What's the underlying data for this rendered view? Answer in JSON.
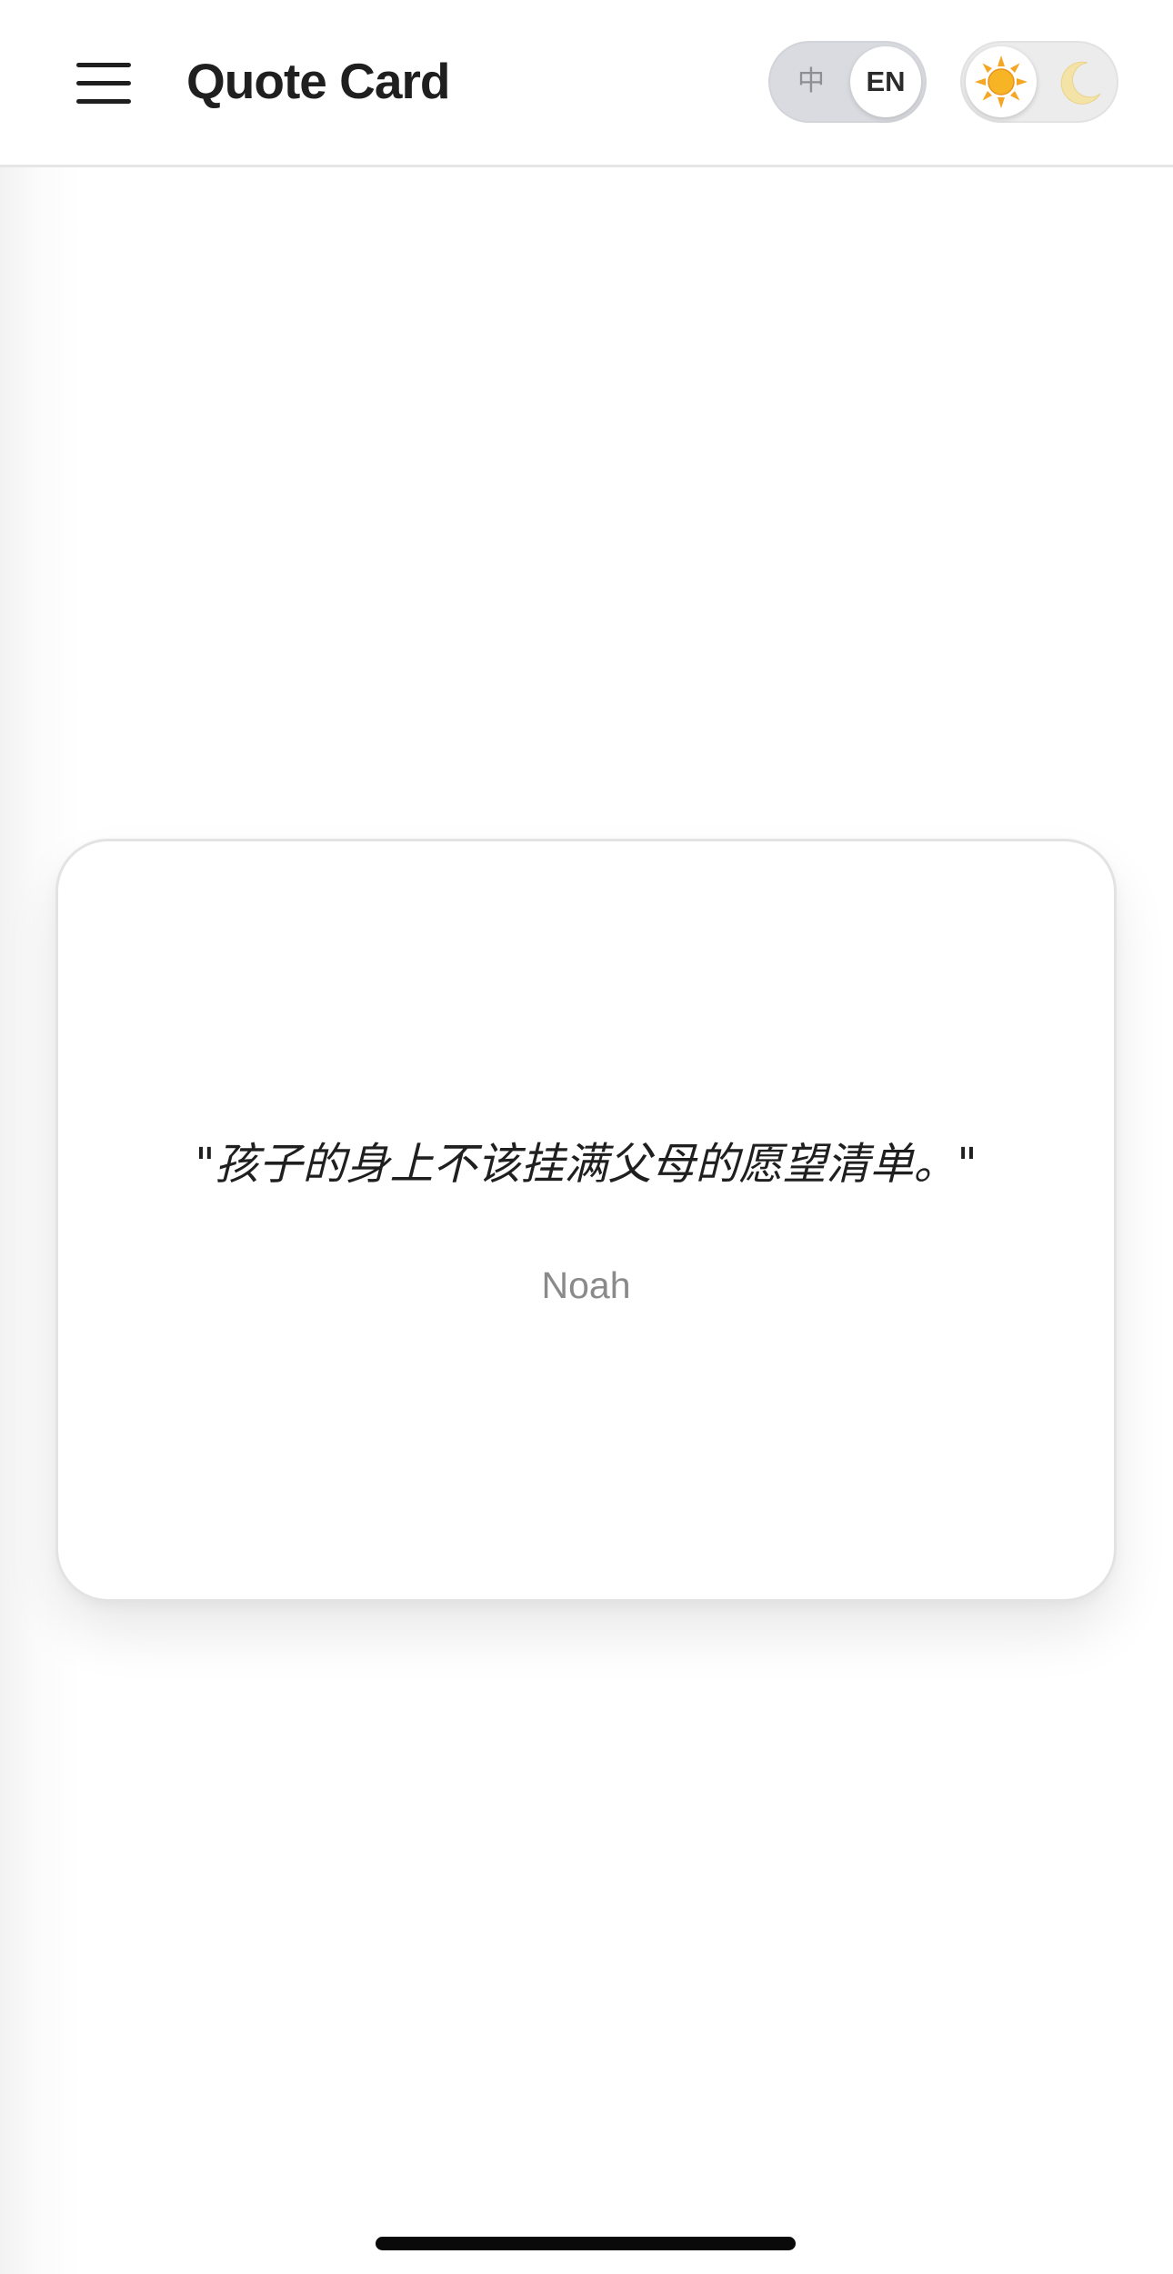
{
  "header": {
    "title": "Quote Card",
    "menu_icon": "hamburger-menu-icon",
    "language_toggle": {
      "option_zh": "中",
      "option_en": "EN",
      "selected": "EN"
    },
    "theme_toggle": {
      "light_icon": "sun-icon",
      "dark_icon": "moon-icon",
      "selected": "light"
    }
  },
  "quote": {
    "text": "\"孩子的身上不该挂满父母的愿望清单。\"",
    "author": "Noah"
  },
  "colors": {
    "background": "#ffffff",
    "text": "#1f1f1f",
    "author_text": "#8a8a8a",
    "card_border": "#e3e3e3",
    "sun": "#f5a623",
    "moon": "#f3e3a6"
  }
}
